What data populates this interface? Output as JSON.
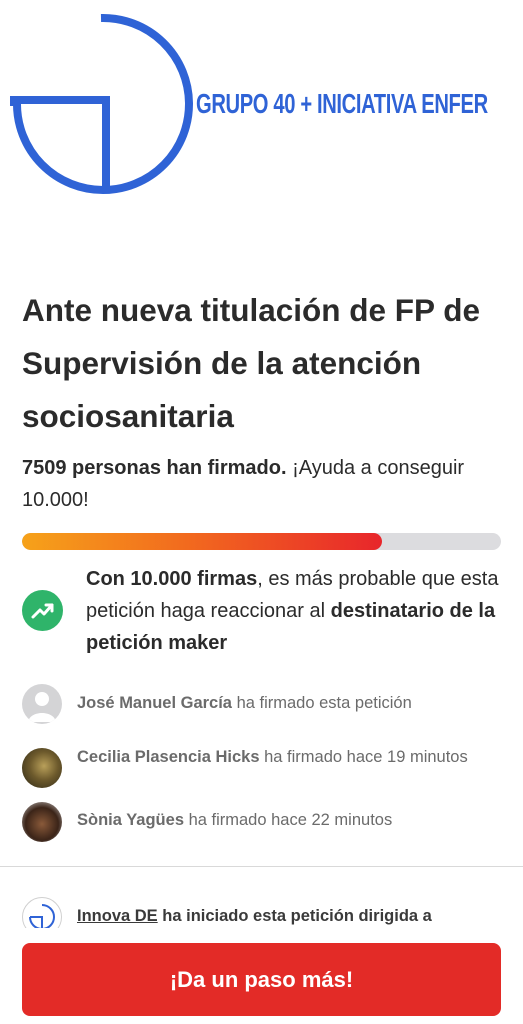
{
  "banner": {
    "title": "GRUPO 40 + INICIATIVA ENFER"
  },
  "petition": {
    "title": "Ante nueva titulación de FP de Supervisión de la atención sociosanitaria",
    "signed_count_text": "7509 personas han firmado.",
    "goal_prompt": " ¡Ayuda a conseguir 10.000!",
    "progress": 0.7509
  },
  "goal_message": {
    "lead": "Con 10.000 firmas",
    "middle": ", es más probable que esta petición haga reaccionar al ",
    "target": "destinatario de la petición maker",
    "icon": "trending-up-icon",
    "icon_color": "#2fb46a"
  },
  "signers": [
    {
      "name": "José Manuel García",
      "action": " ha firmado esta petición"
    },
    {
      "name": "Cecilia Plasencia Hicks",
      "action": " ha firmado hace 19 minutos"
    },
    {
      "name": "Sònia Yagües",
      "action": " ha firmado hace 22 minutos"
    }
  ],
  "starter": {
    "org": "Innova DE",
    "text": " ha iniciado esta petición dirigida a"
  },
  "cta": {
    "label": "¡Da un paso más!",
    "color": "#e32b27"
  },
  "colors": {
    "brand_blue": "#2f63d6",
    "progress_start": "#f6a21a",
    "progress_end": "#e8262b"
  }
}
